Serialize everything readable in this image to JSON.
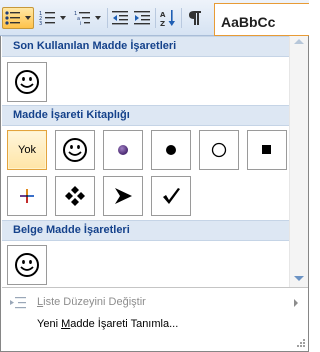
{
  "toolbar": {
    "buttons": [
      {
        "name": "bullets-button",
        "icon": "bullets-list-icon",
        "active": true
      },
      {
        "name": "numbering-button",
        "icon": "numbered-list-icon",
        "active": false
      },
      {
        "name": "multilevel-list-button",
        "icon": "multilevel-list-icon",
        "active": false
      },
      {
        "name": "decrease-indent-button",
        "icon": "decrease-indent-icon",
        "active": false
      },
      {
        "name": "increase-indent-button",
        "icon": "increase-indent-icon",
        "active": false
      },
      {
        "name": "sort-button",
        "icon": "sort-az-icon",
        "active": false
      },
      {
        "name": "show-formatting-button",
        "icon": "pilcrow-icon",
        "active": false
      }
    ],
    "style_preview": "AaBbCc"
  },
  "dropdown": {
    "sections": {
      "recent": {
        "title": "Son Kullanılan Madde İşaretleri",
        "tiles": [
          {
            "glyph": "smiley-icon"
          }
        ]
      },
      "library": {
        "title": "Madde İşareti Kitaplığı",
        "tiles": [
          {
            "text": "Yok",
            "selected": true
          },
          {
            "glyph": "smiley-icon"
          },
          {
            "glyph": "purple-dot-icon"
          },
          {
            "glyph": "filled-circle-icon"
          },
          {
            "glyph": "hollow-circle-icon"
          },
          {
            "glyph": "filled-square-icon"
          },
          {
            "glyph": "color-cross-icon"
          },
          {
            "glyph": "diamond-cluster-icon"
          },
          {
            "glyph": "arrowhead-icon"
          },
          {
            "glyph": "checkmark-icon"
          }
        ]
      },
      "document": {
        "title": "Belge Madde İşaretleri",
        "tiles": [
          {
            "glyph": "smiley-icon"
          }
        ]
      }
    },
    "menu": {
      "change_level": {
        "pre": "",
        "key": "L",
        "post": "iste Düzeyini Değiştir",
        "disabled": true
      },
      "define_new": {
        "pre": "Yeni ",
        "key": "M",
        "post": "adde İşareti Tanımla...",
        "disabled": false
      }
    }
  },
  "colors": {
    "header_text": "#15428b",
    "header_bg": "#dde7f3",
    "selected_tile": "#ffe5a6",
    "purple_bullet": "#6a3d8f"
  }
}
